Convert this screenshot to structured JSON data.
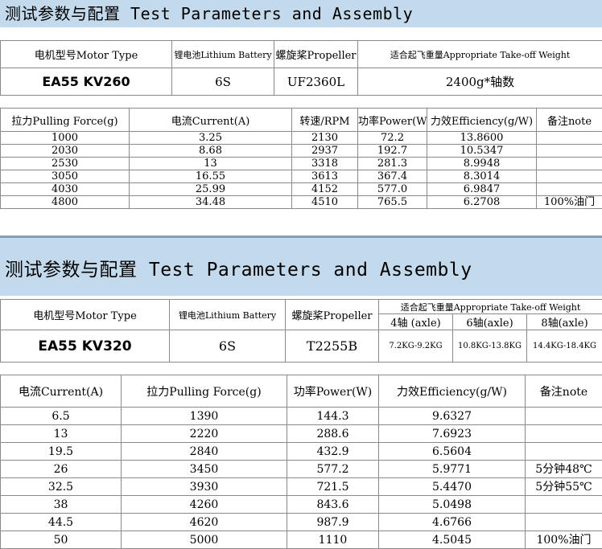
{
  "section1": {
    "title": "测试参数与配置 Test Parameters and Assembly",
    "config_headers": [
      "电机型号Motor Type",
      "锂电池Lithium Battery",
      "螺旋桨Propeller",
      "适合起飞重量Appropriate Take-off Weight"
    ],
    "config_values": [
      "EA55 KV260",
      "6S",
      "UF2360L",
      "2400g*轴数"
    ],
    "table_headers": [
      "拉力Pulling Force(g)",
      "电流Current(A)",
      "转速/RPM",
      "功率Power(W)",
      "力效Efficiency(g/W)",
      "备注note"
    ],
    "rows": [
      [
        "1000",
        "3.25",
        "2130",
        "72.2",
        "13.8600",
        ""
      ],
      [
        "2030",
        "8.68",
        "2937",
        "192.7",
        "10.5347",
        ""
      ],
      [
        "2530",
        "13",
        "3318",
        "281.3",
        "8.9948",
        ""
      ],
      [
        "3050",
        "16.55",
        "3613",
        "367.4",
        "8.3014",
        ""
      ],
      [
        "4030",
        "25.99",
        "4152",
        "577.0",
        "6.9847",
        ""
      ],
      [
        "4800",
        "34.48",
        "4510",
        "765.5",
        "6.2708",
        "100%油门"
      ]
    ]
  },
  "section2": {
    "title": "测试参数与配置 Test Parameters and Assembly",
    "config_headers": [
      "电机型号Motor Type",
      "锂电池Lithium Battery",
      "螺旋桨Propeller",
      "适合起飞重量Appropriate Take-off Weight"
    ],
    "axle_headers": [
      "4轴 (axle)",
      "6轴(axle)",
      "8轴(axle)"
    ],
    "config_values": [
      "EA55 KV320",
      "6S",
      "T2255B"
    ],
    "axle_values": [
      "7.2KG-9.2KG",
      "10.8KG-13.8KG",
      "14.4KG-18.4KG"
    ],
    "table_headers": [
      "电流Current(A)",
      "拉力Pulling Force(g)",
      "功率Power(W)",
      "力效Efficiency(g/W)",
      "备注note"
    ],
    "rows": [
      [
        "6.5",
        "1390",
        "144.3",
        "9.6327",
        ""
      ],
      [
        "13",
        "2220",
        "288.6",
        "7.6923",
        ""
      ],
      [
        "19.5",
        "2840",
        "432.9",
        "6.5604",
        ""
      ],
      [
        "26",
        "3450",
        "577.2",
        "5.9771",
        "5分钟48℃"
      ],
      [
        "32.5",
        "3930",
        "721.5",
        "5.4470",
        "5分钟55℃"
      ],
      [
        "38",
        "4260",
        "843.6",
        "5.0498",
        ""
      ],
      [
        "44.5",
        "4620",
        "987.9",
        "4.6766",
        ""
      ],
      [
        "50",
        "5000",
        "1110",
        "4.5045",
        "100%油门"
      ]
    ]
  }
}
